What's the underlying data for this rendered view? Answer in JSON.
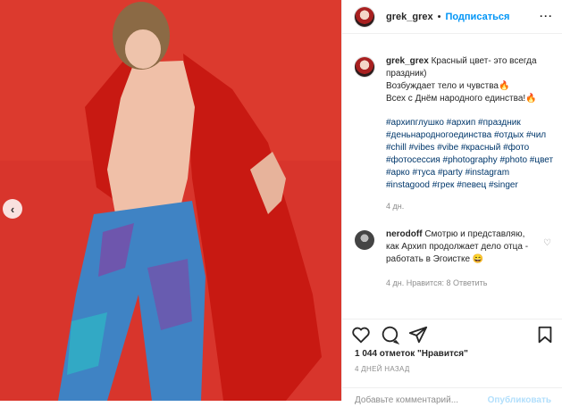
{
  "post": {
    "username": "grek_grex",
    "separator": "•",
    "follow_label": "Подписаться",
    "more_label": "···"
  },
  "caption": {
    "username": "grek_grex",
    "text": "Красный цвет- это всегда праздник)\nВозбуждает тело и чувства🔥\nВсех с Днём народного единства!🔥",
    "hashtags": "#архипглушко #архип #праздник #деньнародногоединства #отдых #чил #chill #vibes #vibe #красный #фото #фотосессия #photography #photo #цвет #арко #туса #party #instagram #instagood #грек #певец #singer",
    "age": "4 дн."
  },
  "comment": {
    "username": "nerodoff",
    "text": "Смотрю и представляю, как Архип продолжает дело отца - работать в Эгоистке 😄",
    "clipped_text": "4 дн.  Нравится: 8  Ответить"
  },
  "stats": {
    "likes": "1 044 отметок \"Нравится\"",
    "date": "4 ДНЕЙ НАЗАД"
  },
  "composer": {
    "placeholder": "Добавьте комментарий...",
    "publish_label": "Опубликовать"
  },
  "media": {
    "background": "#d8352c",
    "nav_prev_glyph": "‹"
  },
  "icons": [
    "heart-icon",
    "comment-icon",
    "share-icon",
    "bookmark-icon",
    "chevron-left-icon",
    "small-heart-icon"
  ]
}
